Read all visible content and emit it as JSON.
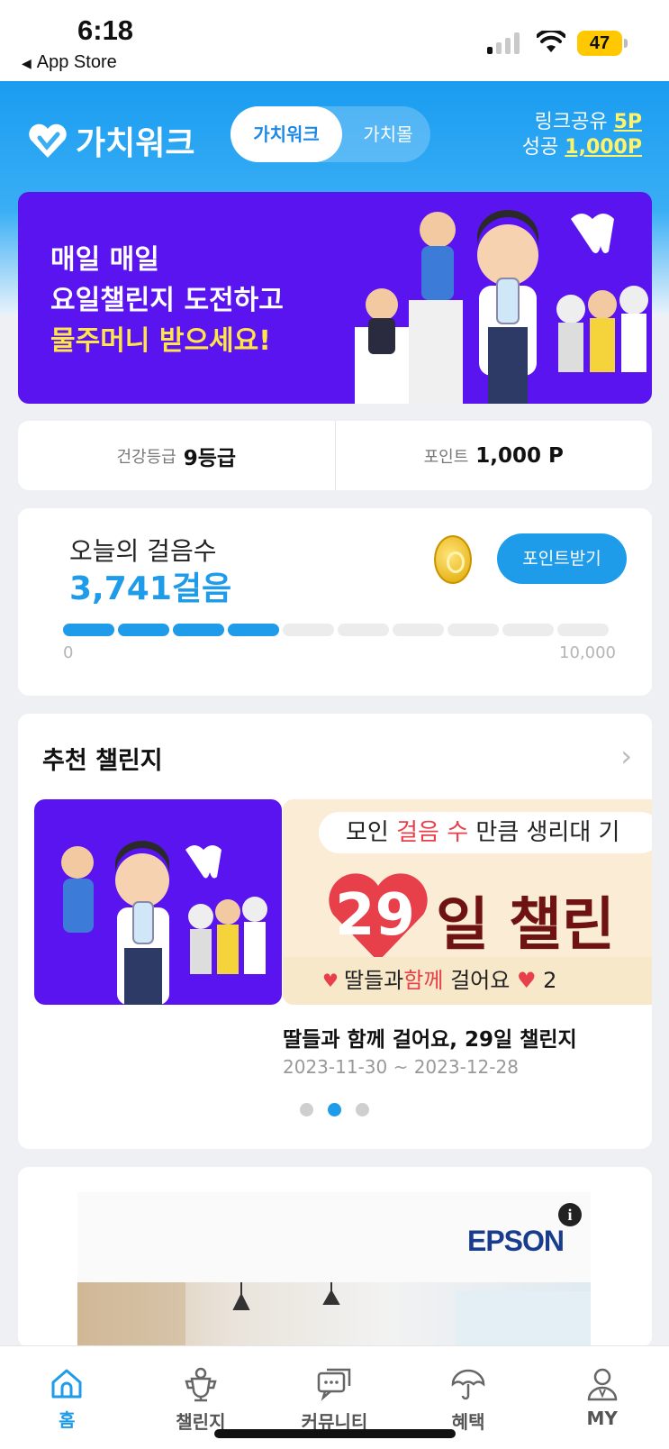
{
  "status_bar": {
    "time": "6:18",
    "back_label": "App Store",
    "battery": "47"
  },
  "header": {
    "logo_text": "가치워크",
    "tabs": [
      {
        "label": "가치워크",
        "active": true
      },
      {
        "label": "가치몰",
        "active": false
      }
    ],
    "promo": {
      "line1_prefix": "링크공유",
      "line1_value": "5P",
      "line2_prefix": "성공",
      "line2_value": "1,000P"
    }
  },
  "hero_banner": {
    "line1": "매일 매일",
    "line2": "요일챌린지 도전하고",
    "line3": "물주머니 받으세요!"
  },
  "grade_card": {
    "grade_label": "건강등급",
    "grade_value": "9등급",
    "point_label": "포인트",
    "point_value": "1,000 P"
  },
  "steps_card": {
    "label": "오늘의 걸음수",
    "value": "3,741걸음",
    "button_label": "포인트받기",
    "progress_fraction": 0.3741,
    "scale_min": "0",
    "scale_max": "10,000"
  },
  "recommended": {
    "title": "추천 챌린지",
    "slide": {
      "pill_prefix": "모인",
      "pill_highlight": "걸음 수",
      "pill_suffix": "만큼 생리대 기",
      "big_number": "29",
      "big_text": "일 챌린",
      "bottom_prefix": "딸들과",
      "bottom_highlight": "함께",
      "bottom_suffix": "걸어요",
      "bottom_tail": "2"
    },
    "challenge_title": "딸들과 함께 걸어요, 29일 챌린지",
    "challenge_date": "2023-11-30 ~ 2023-12-28",
    "dots": [
      false,
      true,
      false
    ]
  },
  "ad": {
    "brand": "EPSON",
    "info": "i"
  },
  "bottom_nav": [
    {
      "label": "홈",
      "icon": "home-icon",
      "active": true
    },
    {
      "label": "챌린지",
      "icon": "trophy-icon",
      "active": false
    },
    {
      "label": "커뮤니티",
      "icon": "chat-icon",
      "active": false
    },
    {
      "label": "혜택",
      "icon": "umbrella-icon",
      "active": false
    },
    {
      "label": "MY",
      "icon": "person-icon",
      "active": false
    }
  ],
  "colors": {
    "primary": "#1e9be9",
    "banner_purple": "#5a14f0",
    "highlight_yellow": "#ffe44a",
    "accent_red": "#e8404a"
  }
}
